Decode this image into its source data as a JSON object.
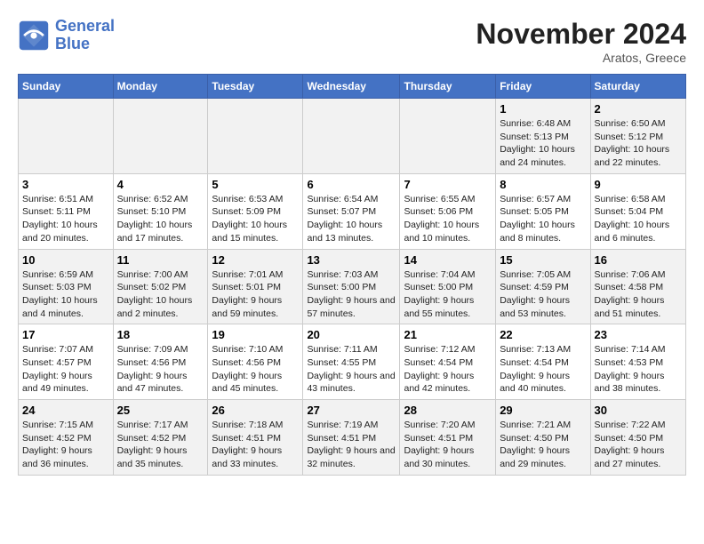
{
  "header": {
    "logo_line1": "General",
    "logo_line2": "Blue",
    "month": "November 2024",
    "location": "Aratos, Greece"
  },
  "days_of_week": [
    "Sunday",
    "Monday",
    "Tuesday",
    "Wednesday",
    "Thursday",
    "Friday",
    "Saturday"
  ],
  "weeks": [
    [
      {
        "day": "",
        "info": ""
      },
      {
        "day": "",
        "info": ""
      },
      {
        "day": "",
        "info": ""
      },
      {
        "day": "",
        "info": ""
      },
      {
        "day": "",
        "info": ""
      },
      {
        "day": "1",
        "info": "Sunrise: 6:48 AM\nSunset: 5:13 PM\nDaylight: 10 hours\nand 24 minutes."
      },
      {
        "day": "2",
        "info": "Sunrise: 6:50 AM\nSunset: 5:12 PM\nDaylight: 10 hours\nand 22 minutes."
      }
    ],
    [
      {
        "day": "3",
        "info": "Sunrise: 6:51 AM\nSunset: 5:11 PM\nDaylight: 10 hours\nand 20 minutes."
      },
      {
        "day": "4",
        "info": "Sunrise: 6:52 AM\nSunset: 5:10 PM\nDaylight: 10 hours\nand 17 minutes."
      },
      {
        "day": "5",
        "info": "Sunrise: 6:53 AM\nSunset: 5:09 PM\nDaylight: 10 hours\nand 15 minutes."
      },
      {
        "day": "6",
        "info": "Sunrise: 6:54 AM\nSunset: 5:07 PM\nDaylight: 10 hours\nand 13 minutes."
      },
      {
        "day": "7",
        "info": "Sunrise: 6:55 AM\nSunset: 5:06 PM\nDaylight: 10 hours\nand 10 minutes."
      },
      {
        "day": "8",
        "info": "Sunrise: 6:57 AM\nSunset: 5:05 PM\nDaylight: 10 hours\nand 8 minutes."
      },
      {
        "day": "9",
        "info": "Sunrise: 6:58 AM\nSunset: 5:04 PM\nDaylight: 10 hours\nand 6 minutes."
      }
    ],
    [
      {
        "day": "10",
        "info": "Sunrise: 6:59 AM\nSunset: 5:03 PM\nDaylight: 10 hours\nand 4 minutes."
      },
      {
        "day": "11",
        "info": "Sunrise: 7:00 AM\nSunset: 5:02 PM\nDaylight: 10 hours\nand 2 minutes."
      },
      {
        "day": "12",
        "info": "Sunrise: 7:01 AM\nSunset: 5:01 PM\nDaylight: 9 hours\nand 59 minutes."
      },
      {
        "day": "13",
        "info": "Sunrise: 7:03 AM\nSunset: 5:00 PM\nDaylight: 9 hours\nand 57 minutes."
      },
      {
        "day": "14",
        "info": "Sunrise: 7:04 AM\nSunset: 5:00 PM\nDaylight: 9 hours\nand 55 minutes."
      },
      {
        "day": "15",
        "info": "Sunrise: 7:05 AM\nSunset: 4:59 PM\nDaylight: 9 hours\nand 53 minutes."
      },
      {
        "day": "16",
        "info": "Sunrise: 7:06 AM\nSunset: 4:58 PM\nDaylight: 9 hours\nand 51 minutes."
      }
    ],
    [
      {
        "day": "17",
        "info": "Sunrise: 7:07 AM\nSunset: 4:57 PM\nDaylight: 9 hours\nand 49 minutes."
      },
      {
        "day": "18",
        "info": "Sunrise: 7:09 AM\nSunset: 4:56 PM\nDaylight: 9 hours\nand 47 minutes."
      },
      {
        "day": "19",
        "info": "Sunrise: 7:10 AM\nSunset: 4:56 PM\nDaylight: 9 hours\nand 45 minutes."
      },
      {
        "day": "20",
        "info": "Sunrise: 7:11 AM\nSunset: 4:55 PM\nDaylight: 9 hours\nand 43 minutes."
      },
      {
        "day": "21",
        "info": "Sunrise: 7:12 AM\nSunset: 4:54 PM\nDaylight: 9 hours\nand 42 minutes."
      },
      {
        "day": "22",
        "info": "Sunrise: 7:13 AM\nSunset: 4:54 PM\nDaylight: 9 hours\nand 40 minutes."
      },
      {
        "day": "23",
        "info": "Sunrise: 7:14 AM\nSunset: 4:53 PM\nDaylight: 9 hours\nand 38 minutes."
      }
    ],
    [
      {
        "day": "24",
        "info": "Sunrise: 7:15 AM\nSunset: 4:52 PM\nDaylight: 9 hours\nand 36 minutes."
      },
      {
        "day": "25",
        "info": "Sunrise: 7:17 AM\nSunset: 4:52 PM\nDaylight: 9 hours\nand 35 minutes."
      },
      {
        "day": "26",
        "info": "Sunrise: 7:18 AM\nSunset: 4:51 PM\nDaylight: 9 hours\nand 33 minutes."
      },
      {
        "day": "27",
        "info": "Sunrise: 7:19 AM\nSunset: 4:51 PM\nDaylight: 9 hours\nand 32 minutes."
      },
      {
        "day": "28",
        "info": "Sunrise: 7:20 AM\nSunset: 4:51 PM\nDaylight: 9 hours\nand 30 minutes."
      },
      {
        "day": "29",
        "info": "Sunrise: 7:21 AM\nSunset: 4:50 PM\nDaylight: 9 hours\nand 29 minutes."
      },
      {
        "day": "30",
        "info": "Sunrise: 7:22 AM\nSunset: 4:50 PM\nDaylight: 9 hours\nand 27 minutes."
      }
    ]
  ]
}
